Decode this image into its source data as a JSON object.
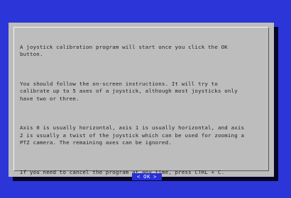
{
  "dialog": {
    "paragraphs": [
      "A joystick calibration program will start once you click the OK\nbutton.",
      "You should follow the on-screen instructions. It will try to\ncalibrate up to 5 axes of a joystick, although most joysticks only\nhave two or three.",
      "Axis 0 is usually horizontal, axis 1 is usually horizontal, and axis\n2 is usually a twist of the joystick which can be used for zooming a\nPTZ camera. The remaining axes can be ignored.",
      "If you need to cancel the program at any time, press CTRL + C."
    ],
    "ok_button": {
      "label": "OK",
      "left_bracket": "<",
      "right_bracket": ">"
    }
  },
  "colors": {
    "background": "#2c35d8",
    "dialog": "#bdbdbd",
    "shadow": "#050525",
    "button": "#2830d8",
    "text": "#1f1f1f"
  }
}
